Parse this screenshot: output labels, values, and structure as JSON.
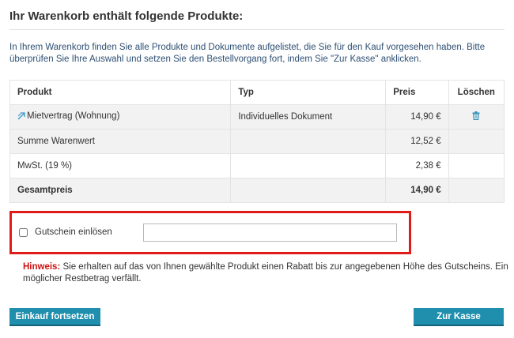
{
  "page": {
    "title": "Ihr Warenkorb enthält folgende Produkte:",
    "intro": "In Ihrem Warenkorb finden Sie alle Produkte und Dokumente aufgelistet, die Sie für den Kauf vorgesehen haben. Bitte überprüfen Sie Ihre Auswahl und setzen Sie den Bestellvorgang fort, indem Sie \"Zur Kasse\" anklicken."
  },
  "table": {
    "headers": {
      "product": "Produkt",
      "type": "Typ",
      "price": "Preis",
      "delete": "Löschen"
    },
    "item": {
      "product": "Mietvertrag (Wohnung)",
      "type": "Individuelles Dokument",
      "price": "14,90 €",
      "product_icon": "external-link-icon",
      "delete_icon": "trash-icon"
    },
    "rows": [
      {
        "label": "Summe Warenwert",
        "price": "12,52 €"
      },
      {
        "label": "MwSt. (19 %)",
        "price": "2,38 €"
      },
      {
        "label": "Gesamtpreis",
        "price": "14,90 €"
      }
    ]
  },
  "voucher": {
    "label": "Gutschein einlösen",
    "checked": false,
    "input_value": "",
    "highlight_color": "#e11a1a"
  },
  "hint": {
    "label": "Hinweis:",
    "text": " Sie erhalten auf das von Ihnen gewählte Produkt einen Rabatt bis zur angegebenen Höhe des Gutscheins. Ein möglicher Restbetrag verfällt."
  },
  "buttons": {
    "continue": "Einkauf fortsetzen",
    "checkout": "Zur Kasse",
    "color": "#1f8fad"
  }
}
